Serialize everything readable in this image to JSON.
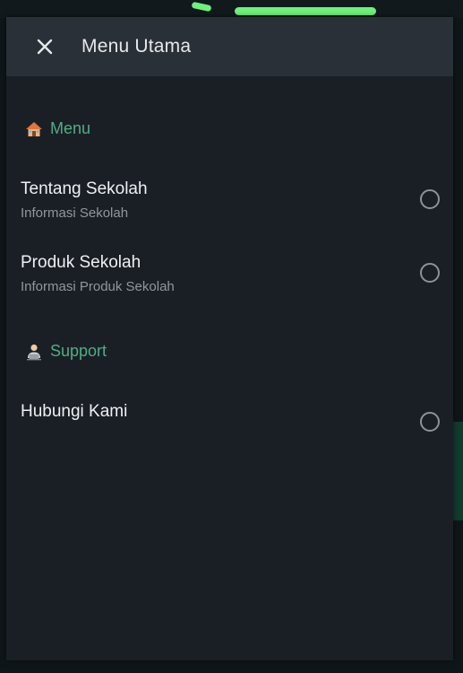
{
  "header": {
    "title": "Menu Utama",
    "close_icon": "close-icon"
  },
  "sections": [
    {
      "icon": "house-icon",
      "label": "Menu",
      "items": [
        {
          "title": "Tentang Sekolah",
          "subtitle": "Informasi Sekolah",
          "selected": false
        },
        {
          "title": "Produk Sekolah",
          "subtitle": "Informasi Produk Sekolah",
          "selected": false
        }
      ]
    },
    {
      "icon": "technologist-icon",
      "label": "Support",
      "items": [
        {
          "title": "Hubungi Kami",
          "selected": false
        }
      ]
    }
  ],
  "colors": {
    "accent": "#4fae84",
    "header_bg": "#2a3037",
    "sheet_bg": "#1a1f25"
  }
}
